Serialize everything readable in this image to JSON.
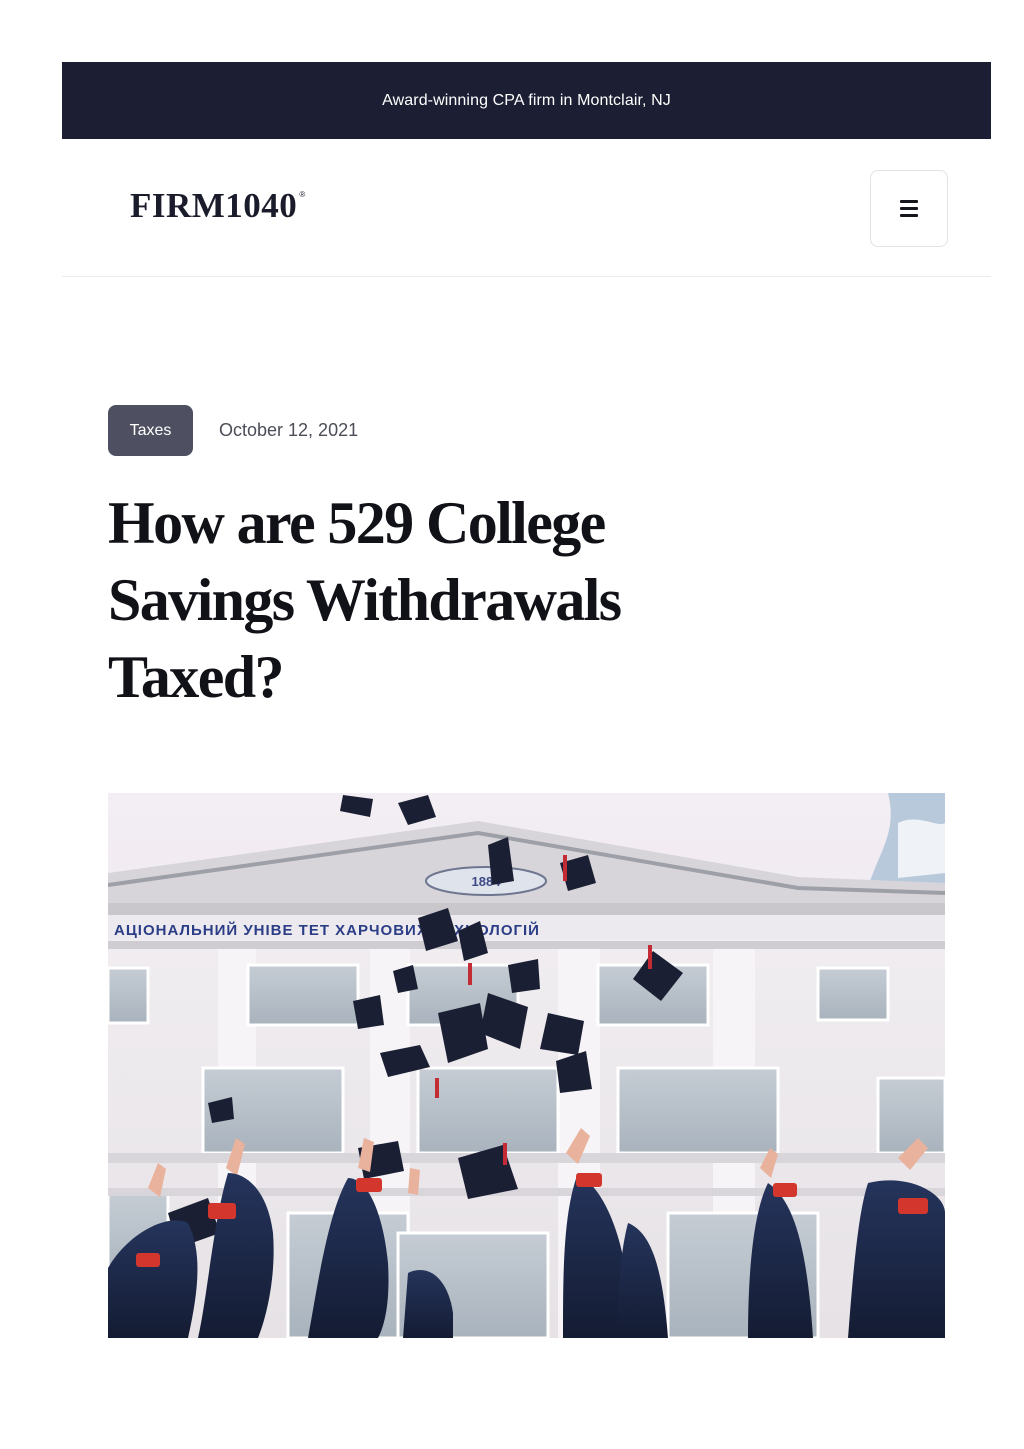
{
  "announcement": {
    "text": "Award-winning CPA firm in Montclair, NJ"
  },
  "header": {
    "logo_text": "FIRM1040",
    "logo_mark": "®",
    "menu_icon": "hamburger-icon"
  },
  "post": {
    "category": "Taxes",
    "date": "October 12, 2021",
    "title": "How are 529 College Savings Withdrawals Taxed?"
  },
  "hero": {
    "building_sign_text": "АЦІОНАЛЬНИЙ УНІВЕ    ТЕТ ХАРЧОВИХ ТЕХНОЛОГІЙ",
    "building_year_text": "1884"
  },
  "colors": {
    "announce_bg": "#1c1f33",
    "badge_bg": "#4e5061",
    "title": "#111217"
  }
}
